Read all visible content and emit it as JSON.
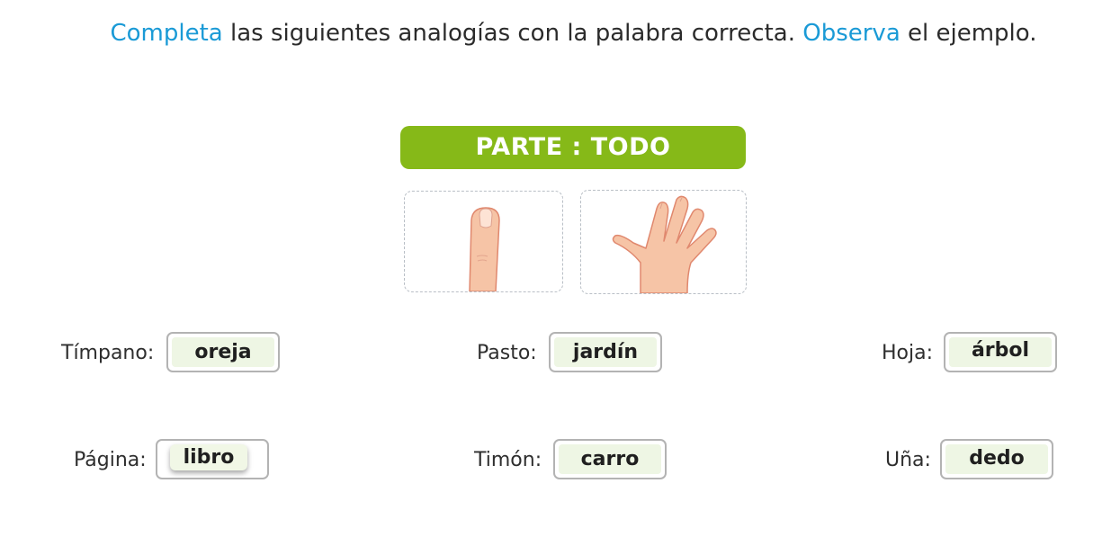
{
  "instruction": {
    "part1": "Completa",
    "part2": " las siguientes analogías con la palabra correcta. ",
    "part3": "Observa",
    "part4": " el ejemplo."
  },
  "example": {
    "relation": "PARTE : TODO",
    "images": [
      "finger-image",
      "hand-image"
    ]
  },
  "analogies": [
    {
      "prompt": "Tímpano:",
      "answer": "oreja"
    },
    {
      "prompt": "Pasto:",
      "answer": "jardín"
    },
    {
      "prompt": "Hoja:",
      "answer": "árbol"
    },
    {
      "prompt": "Página:",
      "answer": "libro"
    },
    {
      "prompt": "Timón:",
      "answer": "carro"
    },
    {
      "prompt": "Uña:",
      "answer": "dedo"
    }
  ],
  "colors": {
    "accent_text": "#1a9ad6",
    "banner": "#86b918",
    "answer_chip": "#eef6e4",
    "skin": "#f6c4a6"
  }
}
